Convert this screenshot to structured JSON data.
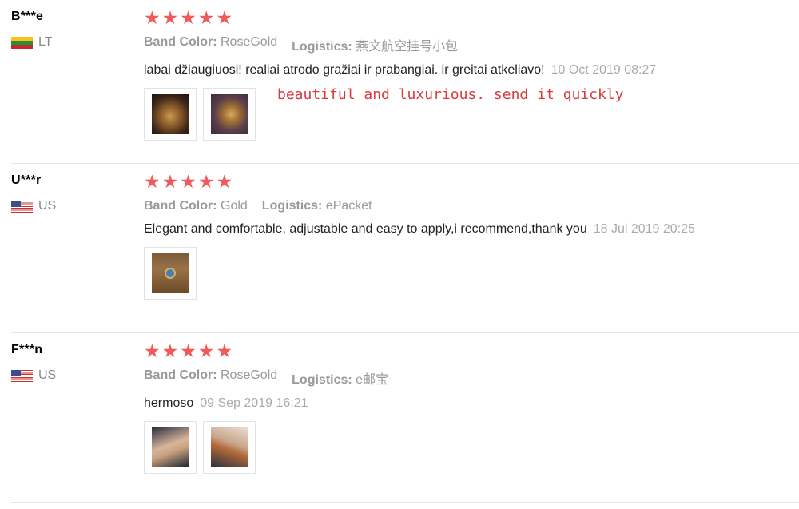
{
  "labels": {
    "band_color": "Band Color:",
    "logistics": "Logistics:"
  },
  "star_glyph": "★",
  "star_color": "#f05a5a",
  "reviews": [
    {
      "user": "B***e",
      "country": "LT",
      "flag": "lithuania-flag",
      "rating": 5,
      "band_color": "RoseGold",
      "logistics": "燕文航空挂号小包",
      "text": "labai džiaugiuosi! realiai atrodo gražiai ir prabangiai. ir greitai atkeliavo!",
      "date": "10 Oct 2019 08:27",
      "translation": "beautiful and luxurious. send it quickly"
    },
    {
      "user": "U***r",
      "country": "US",
      "flag": "us-flag",
      "rating": 5,
      "band_color": "Gold",
      "logistics": "ePacket",
      "text": "Elegant and comfortable, adjustable and easy to apply,i recommend,thank you",
      "date": "18 Jul 2019 20:25"
    },
    {
      "user": "F***n",
      "country": "US",
      "flag": "us-flag",
      "rating": 5,
      "band_color": "RoseGold",
      "logistics": "e邮宝",
      "text": "hermoso",
      "date": "09 Sep 2019 16:21"
    }
  ]
}
